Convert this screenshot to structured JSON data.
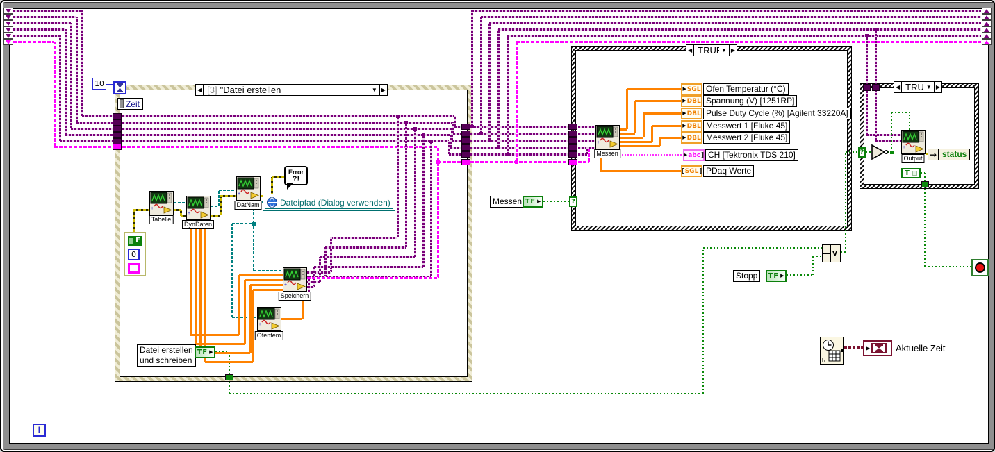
{
  "colors": {
    "cluster_wire": "#7A007A",
    "string_wire": "#FF00FF",
    "boolean_wire": "#0B8A0B",
    "numeric_wire": "#FF8200",
    "path_wire": "#008080",
    "error_wire_yellow": "#CCBA00",
    "time_wire": "#7B1230",
    "int_wire": "#2A2AD4",
    "loop_border": "#8F8F8F"
  },
  "while_loop": {
    "iteration_label": "i"
  },
  "glyphs": {
    "question": "?",
    "left_arrow": "◀",
    "right_arrow": "▶",
    "dropdown": "▼",
    "terminal_arrow": "▶",
    "status_arrow": "→"
  },
  "main_case": {
    "selector_index": "[3]",
    "selector_title": "\"Datei erstellen",
    "wait_constant": "10",
    "zeit_label": "Zeit",
    "subvi_tabelle": "Tabelle",
    "subvi_dyndaten": "DynDaten",
    "subvi_datnam": "DatNam",
    "subvi_speichern": "Speichern",
    "subvi_ofentem": "Ofentem",
    "error_bubble": {
      "line1": "Error",
      "line2": "?!"
    },
    "filepath_control": "Dateipfad (Dialog verwenden)",
    "cluster_constant": {
      "bool": "F",
      "numeric": "0"
    },
    "create_file_control": {
      "line1": "Datei erstellen",
      "line2": "und schreiben",
      "terminal": "TF"
    }
  },
  "measure_case": {
    "selector": "TRUE",
    "subvi_messen": "Messen",
    "messen_control": {
      "label": "Messen",
      "terminal": "TF"
    },
    "indicators": [
      {
        "type": "SGL",
        "label": "Ofen Temperatur (°C)",
        "kind": "num"
      },
      {
        "type": "DBL",
        "label": "Spannung (V) [1251RP]",
        "kind": "num"
      },
      {
        "type": "DBL",
        "label": "Pulse Duty Cycle (%) [Agilent 33220A]",
        "kind": "num"
      },
      {
        "type": "DBL",
        "label": "Messwert 1 [Fluke 45]",
        "kind": "num"
      },
      {
        "type": "DBL",
        "label": "Messwert 2 [Fluke 45]",
        "kind": "num"
      },
      {
        "type": "abc",
        "label": "CH [Tektronix TDS 210]",
        "kind": "str"
      },
      {
        "type": "SGL",
        "label": "PDaq Werte",
        "kind": "arr"
      }
    ]
  },
  "output_case": {
    "selector": "TRUE",
    "subvi_output": "Output",
    "status_label": "status",
    "true_constant": "T",
    "or_label": "v"
  },
  "stopp_control": {
    "label": "Stopp",
    "terminal": "TF"
  },
  "aktuelle_zeit_label": "Aktuelle Zeit"
}
